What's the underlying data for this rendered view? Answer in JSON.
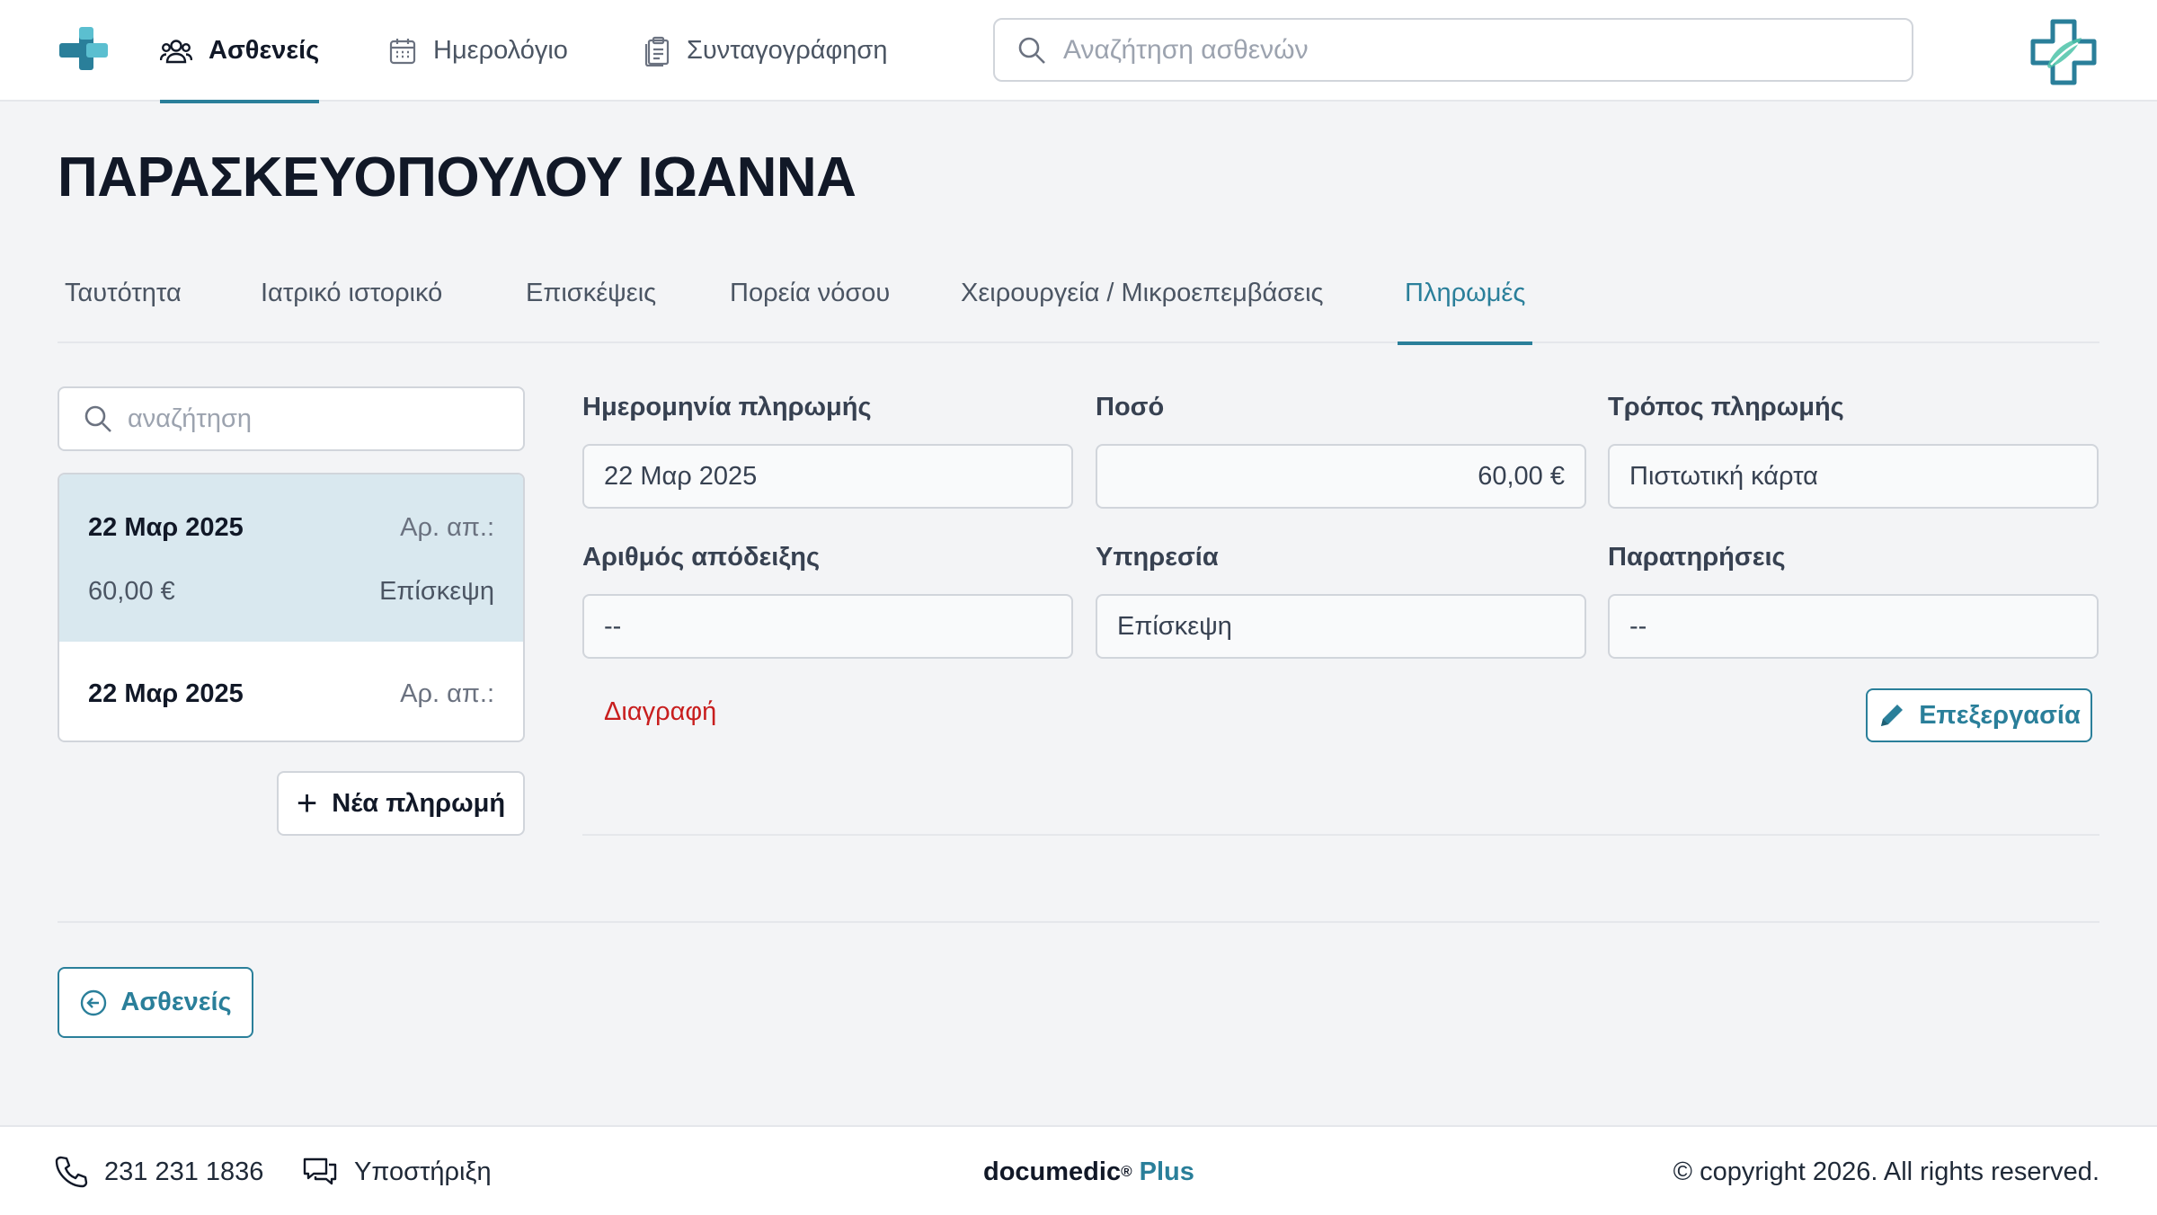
{
  "colors": {
    "accent": "#2a7f9a",
    "danger": "#c81e1e",
    "selected_row": "#d9e8ef"
  },
  "nav": {
    "items": [
      {
        "label": "Ασθενείς",
        "icon": "users-icon",
        "active": true
      },
      {
        "label": "Ημερολόγιο",
        "icon": "calendar-icon",
        "active": false
      },
      {
        "label": "Συνταγογράφηση",
        "icon": "clipboard-icon",
        "active": false
      }
    ],
    "search_placeholder": "Αναζήτηση ασθενών"
  },
  "patient": {
    "name": "ΠΑΡΑΣΚΕΥΟΠΟΥΛΟΥ ΙΩΑΝΝΑ"
  },
  "tabs": [
    {
      "label": "Ταυτότητα",
      "active": false
    },
    {
      "label": "Ιατρικό ιστορικό",
      "active": false
    },
    {
      "label": "Επισκέψεις",
      "active": false
    },
    {
      "label": "Πορεία νόσου",
      "active": false
    },
    {
      "label": "Χειρουργεία / Μικροεπεμβάσεις",
      "active": false
    },
    {
      "label": "Πληρωμές",
      "active": true
    }
  ],
  "payments": {
    "search_placeholder": "αναζήτηση",
    "items": [
      {
        "date": "22 Μαρ 2025",
        "receipt": "Αρ. απ.:",
        "amount": "60,00 €",
        "service": "Επίσκεψη",
        "selected": true
      },
      {
        "date": "22 Μαρ 2025",
        "receipt": "Αρ. απ.:",
        "selected": false
      }
    ],
    "new_button": "Νέα πληρωμή"
  },
  "detail": {
    "date_label": "Ημερομηνία πληρωμής",
    "date_value": "22 Μαρ 2025",
    "amount_label": "Ποσό",
    "amount_value": "60,00 €",
    "method_label": "Τρόπος πληρωμής",
    "method_value": "Πιστωτική κάρτα",
    "receipt_label": "Αριθμός απόδειξης",
    "receipt_value": "--",
    "service_label": "Υπηρεσία",
    "service_value": "Επίσκεψη",
    "notes_label": "Παρατηρήσεις",
    "notes_value": "--",
    "delete_label": "Διαγραφή",
    "edit_label": "Επεξεργασία"
  },
  "back_button": "Ασθενείς",
  "footer": {
    "phone": "231 231 1836",
    "support": "Υποστήριξη",
    "brand": "documedic",
    "brand_mark": "®",
    "brand_plus": "Plus",
    "copyright": "© copyright 2026. All rights reserved."
  }
}
